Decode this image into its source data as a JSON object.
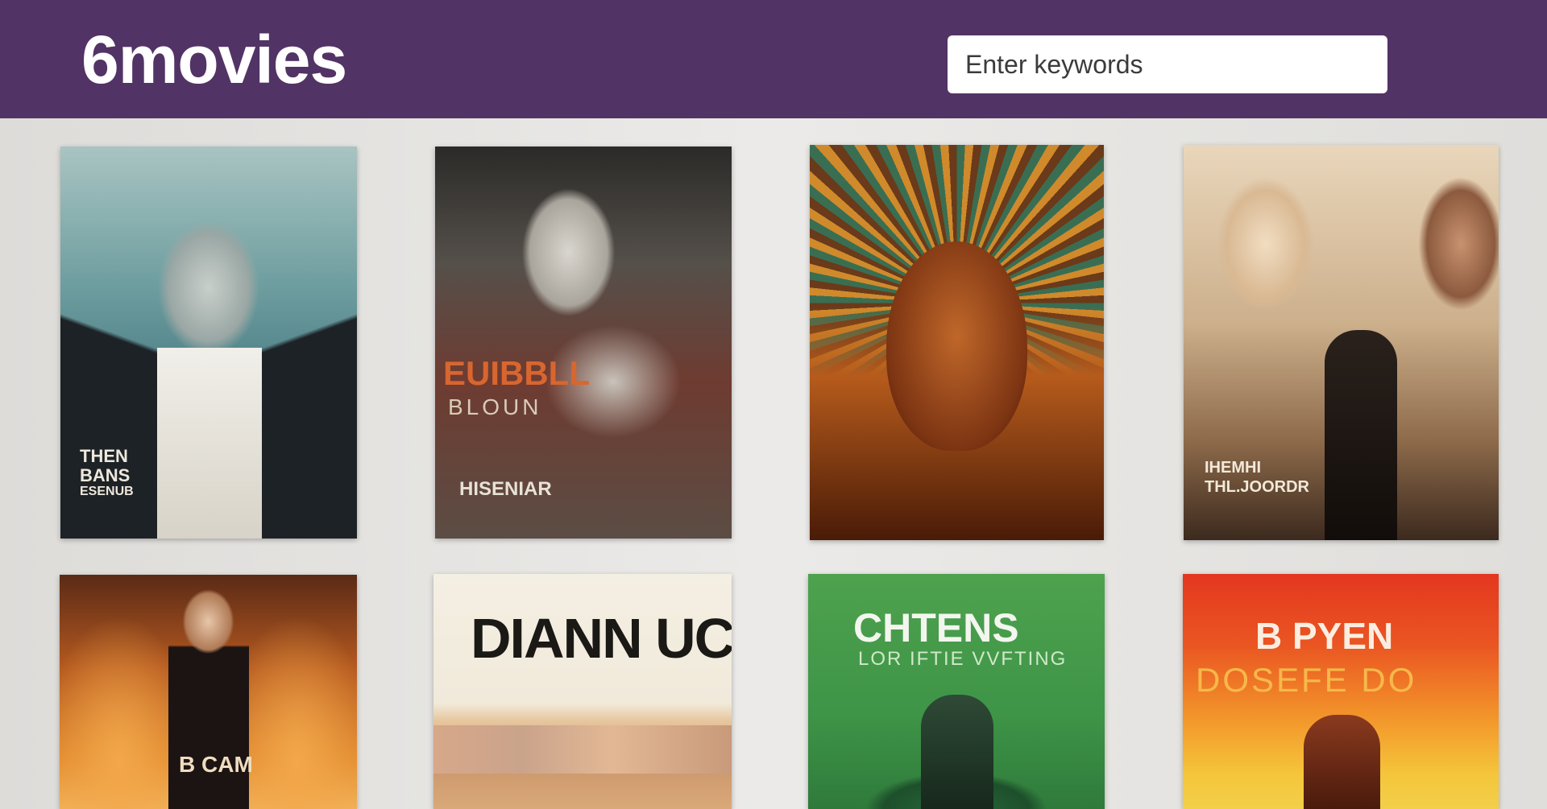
{
  "site": {
    "logo": "6movies"
  },
  "search": {
    "placeholder": "Enter keywords"
  },
  "posters": [
    {
      "lines": [
        "THEN",
        "BANS",
        "ESENUB"
      ]
    },
    {
      "lines": [
        "EUIBBLL",
        "BLOUN",
        "HISENIAR"
      ]
    },
    {
      "lines": []
    },
    {
      "lines": [
        "IHEMHI",
        "THL.JOORDR"
      ]
    },
    {
      "lines": [
        "B CAM"
      ]
    },
    {
      "lines": [
        "DIANN UCT"
      ]
    },
    {
      "lines": [
        "CHTENS",
        "LOR IFTIE VVFTING"
      ]
    },
    {
      "lines": [
        "B PYEN",
        "DOSEFE DO"
      ]
    }
  ],
  "colors": {
    "header": "#523365",
    "background": "#e4e3e1",
    "search_bg": "#ffffff"
  }
}
